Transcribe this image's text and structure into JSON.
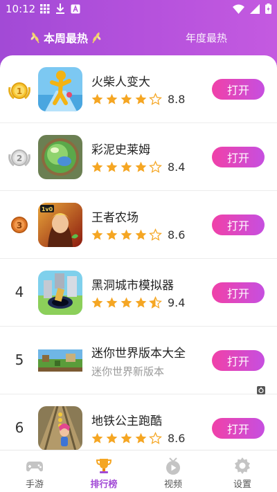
{
  "status_bar": {
    "time": "10:12",
    "left_icons": [
      "grid-icon",
      "download-icon",
      "text-a-icon"
    ],
    "right_icons": [
      "wifi-icon",
      "signal-icon",
      "battery-icon"
    ]
  },
  "tabs": {
    "week_label": "本周最热",
    "year_label": "年度最热",
    "active": "week"
  },
  "colors": {
    "header": "#b451dc",
    "button_start": "#f041a8",
    "button_end": "#c64fe0",
    "star": "#f5a623",
    "active_nav": "#a24ad6"
  },
  "apps": [
    {
      "rank": "1",
      "badge": "gold-medal",
      "name": "火柴人变大",
      "rating": 4,
      "score": "8.8",
      "button": "打开"
    },
    {
      "rank": "2",
      "badge": "silver-medal",
      "name": "彩泥史莱姆",
      "rating": 4,
      "score": "8.4",
      "button": "打开"
    },
    {
      "rank": "3",
      "badge": "bronze-medal",
      "name": "王者农场",
      "rating": 4,
      "score": "8.6",
      "button": "打开"
    },
    {
      "rank": "4",
      "name": "黑洞城市模拟器",
      "rating": 4.5,
      "score": "9.4",
      "button": "打开"
    },
    {
      "rank": "5",
      "name": "迷你世界版本大全",
      "subtitle": "迷你世界新版本",
      "button": "打开",
      "ad": true
    },
    {
      "rank": "6",
      "name": "地铁公主跑酷",
      "rating": 4,
      "score": "8.6",
      "button": "打开"
    }
  ],
  "bottom_nav": [
    {
      "label": "手游",
      "icon": "gamepad-icon"
    },
    {
      "label": "排行榜",
      "icon": "trophy-icon",
      "active": true
    },
    {
      "label": "视频",
      "icon": "tv-icon"
    },
    {
      "label": "设置",
      "icon": "gear-icon"
    }
  ]
}
